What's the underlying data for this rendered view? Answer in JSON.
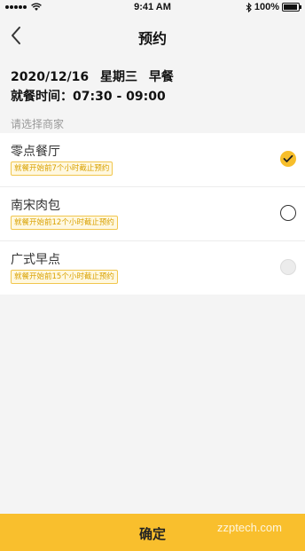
{
  "status_bar": {
    "time": "9:41 AM",
    "battery": "100%"
  },
  "nav": {
    "title": "预约"
  },
  "meal": {
    "date": "2020/12/16",
    "weekday": "星期三",
    "meal_type": "早餐",
    "time_label": "就餐时间：",
    "time_range": "07:30 - 09:00"
  },
  "section": {
    "label": "请选择商家"
  },
  "merchants": [
    {
      "name": "零点餐厅",
      "note": "就餐开始前7个小时截止预约",
      "state": "checked"
    },
    {
      "name": "南宋肉包",
      "note": "就餐开始前12个小时截止预约",
      "state": "unchecked"
    },
    {
      "name": "广式早点",
      "note": "就餐开始前15个小时截止预约",
      "state": "disabled"
    }
  ],
  "confirm": {
    "label": "确定"
  },
  "watermark": "zzptech.com",
  "colors": {
    "accent": "#f9bf2d",
    "tag_text": "#d9a100"
  }
}
